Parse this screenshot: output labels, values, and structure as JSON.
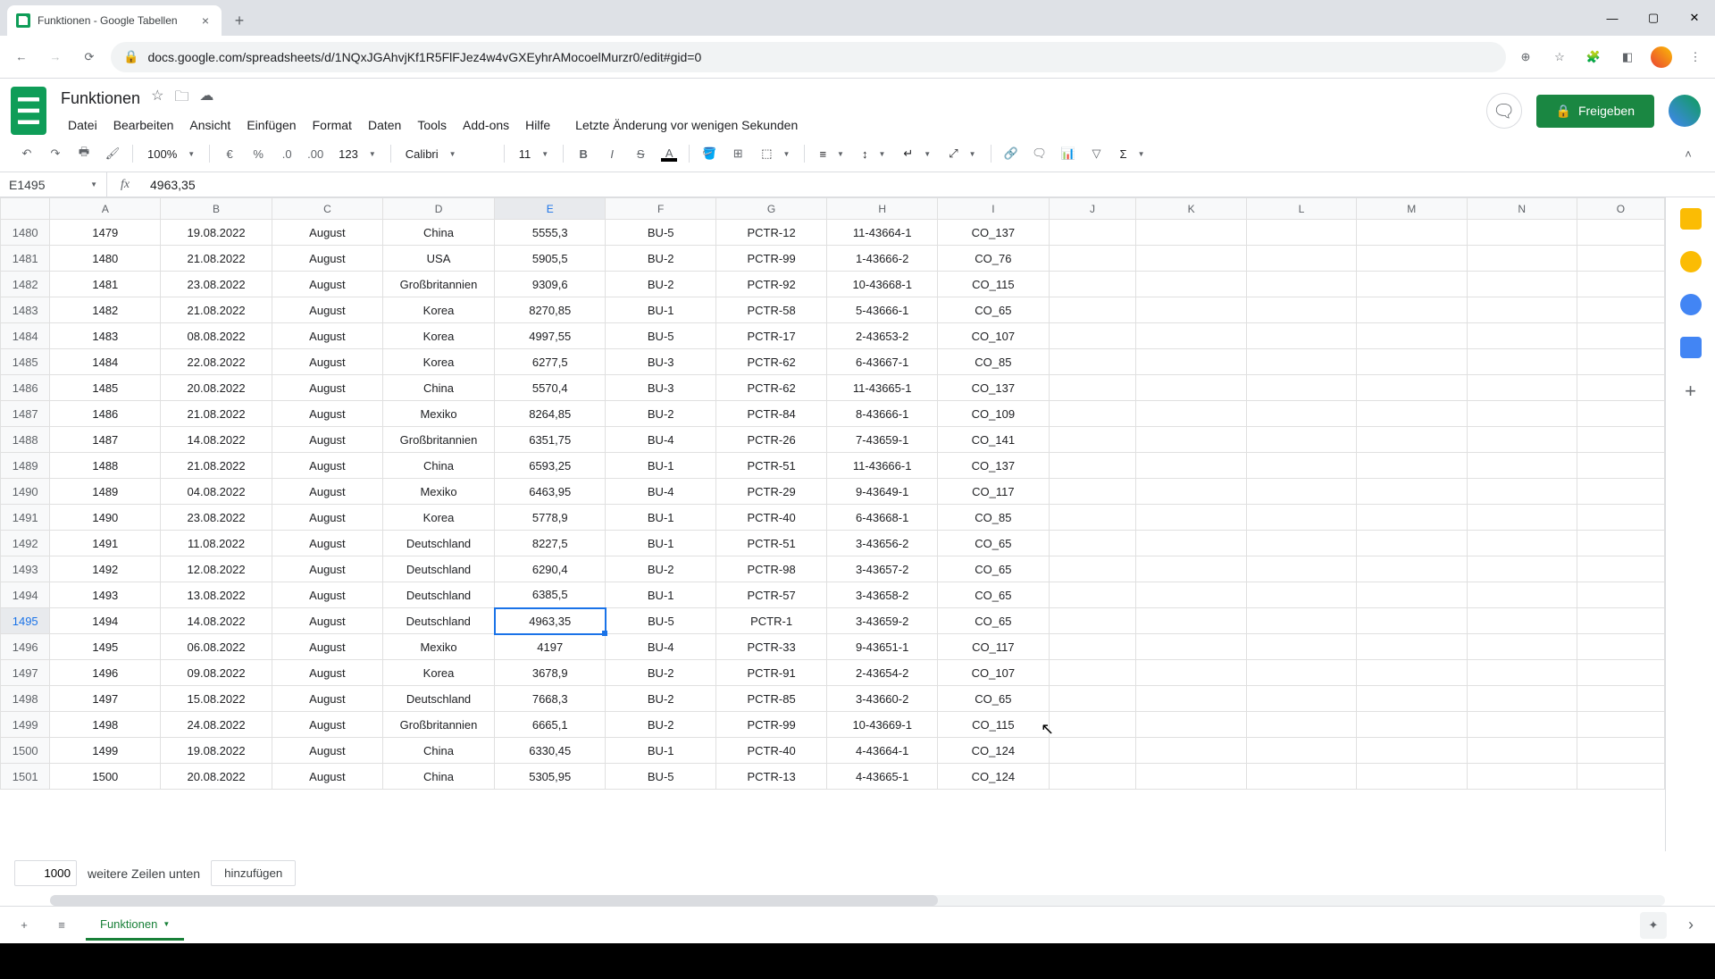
{
  "browser": {
    "tab_title": "Funktionen - Google Tabellen",
    "url": "docs.google.com/spreadsheets/d/1NQxJGAhvjKf1R5FlFJez4w4vGXEyhrAMocoelMurzr0/edit#gid=0"
  },
  "doc": {
    "title": "Funktionen",
    "last_edit": "Letzte Änderung vor wenigen Sekunden"
  },
  "menus": [
    "Datei",
    "Bearbeiten",
    "Ansicht",
    "Einfügen",
    "Format",
    "Daten",
    "Tools",
    "Add-ons",
    "Hilfe"
  ],
  "share_label": "Freigeben",
  "toolbar": {
    "zoom": "100%",
    "euro": "€",
    "pct": "%",
    "dec_dec": ".0",
    "dec_inc": ".00",
    "fmt": "123",
    "font": "Calibri",
    "size": "11"
  },
  "name_box": "E1495",
  "formula": "4963,35",
  "col_headers": [
    "A",
    "B",
    "C",
    "D",
    "E",
    "F",
    "G",
    "H",
    "I",
    "J",
    "K",
    "L",
    "M",
    "N",
    "O"
  ],
  "selected": {
    "row_label": "1495",
    "col": "E"
  },
  "rows": [
    {
      "hdr": "1480",
      "A": "1479",
      "B": "19.08.2022",
      "C": "August",
      "D": "China",
      "E": "5555,3",
      "F": "BU-5",
      "G": "PCTR-12",
      "H": "11-43664-1",
      "I": "CO_137"
    },
    {
      "hdr": "1481",
      "A": "1480",
      "B": "21.08.2022",
      "C": "August",
      "D": "USA",
      "E": "5905,5",
      "F": "BU-2",
      "G": "PCTR-99",
      "H": "1-43666-2",
      "I": "CO_76"
    },
    {
      "hdr": "1482",
      "A": "1481",
      "B": "23.08.2022",
      "C": "August",
      "D": "Großbritannien",
      "E": "9309,6",
      "F": "BU-2",
      "G": "PCTR-92",
      "H": "10-43668-1",
      "I": "CO_115"
    },
    {
      "hdr": "1483",
      "A": "1482",
      "B": "21.08.2022",
      "C": "August",
      "D": "Korea",
      "E": "8270,85",
      "F": "BU-1",
      "G": "PCTR-58",
      "H": "5-43666-1",
      "I": "CO_65"
    },
    {
      "hdr": "1484",
      "A": "1483",
      "B": "08.08.2022",
      "C": "August",
      "D": "Korea",
      "E": "4997,55",
      "F": "BU-5",
      "G": "PCTR-17",
      "H": "2-43653-2",
      "I": "CO_107"
    },
    {
      "hdr": "1485",
      "A": "1484",
      "B": "22.08.2022",
      "C": "August",
      "D": "Korea",
      "E": "6277,5",
      "F": "BU-3",
      "G": "PCTR-62",
      "H": "6-43667-1",
      "I": "CO_85"
    },
    {
      "hdr": "1486",
      "A": "1485",
      "B": "20.08.2022",
      "C": "August",
      "D": "China",
      "E": "5570,4",
      "F": "BU-3",
      "G": "PCTR-62",
      "H": "11-43665-1",
      "I": "CO_137"
    },
    {
      "hdr": "1487",
      "A": "1486",
      "B": "21.08.2022",
      "C": "August",
      "D": "Mexiko",
      "E": "8264,85",
      "F": "BU-2",
      "G": "PCTR-84",
      "H": "8-43666-1",
      "I": "CO_109"
    },
    {
      "hdr": "1488",
      "A": "1487",
      "B": "14.08.2022",
      "C": "August",
      "D": "Großbritannien",
      "E": "6351,75",
      "F": "BU-4",
      "G": "PCTR-26",
      "H": "7-43659-1",
      "I": "CO_141"
    },
    {
      "hdr": "1489",
      "A": "1488",
      "B": "21.08.2022",
      "C": "August",
      "D": "China",
      "E": "6593,25",
      "F": "BU-1",
      "G": "PCTR-51",
      "H": "11-43666-1",
      "I": "CO_137"
    },
    {
      "hdr": "1490",
      "A": "1489",
      "B": "04.08.2022",
      "C": "August",
      "D": "Mexiko",
      "E": "6463,95",
      "F": "BU-4",
      "G": "PCTR-29",
      "H": "9-43649-1",
      "I": "CO_117"
    },
    {
      "hdr": "1491",
      "A": "1490",
      "B": "23.08.2022",
      "C": "August",
      "D": "Korea",
      "E": "5778,9",
      "F": "BU-1",
      "G": "PCTR-40",
      "H": "6-43668-1",
      "I": "CO_85"
    },
    {
      "hdr": "1492",
      "A": "1491",
      "B": "11.08.2022",
      "C": "August",
      "D": "Deutschland",
      "E": "8227,5",
      "F": "BU-1",
      "G": "PCTR-51",
      "H": "3-43656-2",
      "I": "CO_65"
    },
    {
      "hdr": "1493",
      "A": "1492",
      "B": "12.08.2022",
      "C": "August",
      "D": "Deutschland",
      "E": "6290,4",
      "F": "BU-2",
      "G": "PCTR-98",
      "H": "3-43657-2",
      "I": "CO_65"
    },
    {
      "hdr": "1494",
      "A": "1493",
      "B": "13.08.2022",
      "C": "August",
      "D": "Deutschland",
      "E": "6385,5",
      "F": "BU-1",
      "G": "PCTR-57",
      "H": "3-43658-2",
      "I": "CO_65"
    },
    {
      "hdr": "1495",
      "A": "1494",
      "B": "14.08.2022",
      "C": "August",
      "D": "Deutschland",
      "E": "4963,35",
      "F": "BU-5",
      "G": "PCTR-1",
      "H": "3-43659-2",
      "I": "CO_65"
    },
    {
      "hdr": "1496",
      "A": "1495",
      "B": "06.08.2022",
      "C": "August",
      "D": "Mexiko",
      "E": "4197",
      "F": "BU-4",
      "G": "PCTR-33",
      "H": "9-43651-1",
      "I": "CO_117"
    },
    {
      "hdr": "1497",
      "A": "1496",
      "B": "09.08.2022",
      "C": "August",
      "D": "Korea",
      "E": "3678,9",
      "F": "BU-2",
      "G": "PCTR-91",
      "H": "2-43654-2",
      "I": "CO_107"
    },
    {
      "hdr": "1498",
      "A": "1497",
      "B": "15.08.2022",
      "C": "August",
      "D": "Deutschland",
      "E": "7668,3",
      "F": "BU-2",
      "G": "PCTR-85",
      "H": "3-43660-2",
      "I": "CO_65"
    },
    {
      "hdr": "1499",
      "A": "1498",
      "B": "24.08.2022",
      "C": "August",
      "D": "Großbritannien",
      "E": "6665,1",
      "F": "BU-2",
      "G": "PCTR-99",
      "H": "10-43669-1",
      "I": "CO_115"
    },
    {
      "hdr": "1500",
      "A": "1499",
      "B": "19.08.2022",
      "C": "August",
      "D": "China",
      "E": "6330,45",
      "F": "BU-1",
      "G": "PCTR-40",
      "H": "4-43664-1",
      "I": "CO_124"
    },
    {
      "hdr": "1501",
      "A": "1500",
      "B": "20.08.2022",
      "C": "August",
      "D": "China",
      "E": "5305,95",
      "F": "BU-5",
      "G": "PCTR-13",
      "H": "4-43665-1",
      "I": "CO_124"
    }
  ],
  "add_rows": {
    "count": "1000",
    "label_mid": "weitere Zeilen unten",
    "button": "hinzufügen"
  },
  "sheet_name": "Funktionen"
}
